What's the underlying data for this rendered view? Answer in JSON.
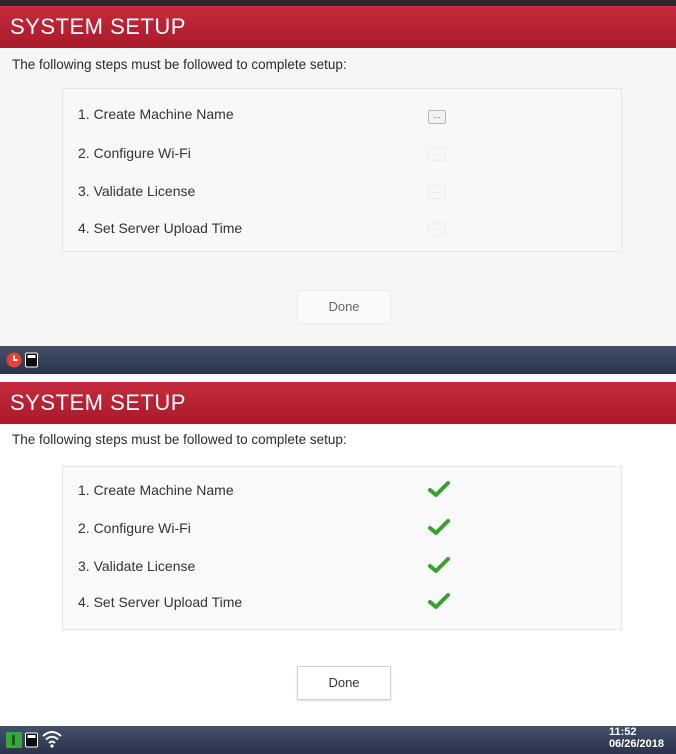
{
  "screens": [
    {
      "title": "SYSTEM SETUP",
      "intro": "The following steps must be followed to complete setup:",
      "steps": [
        {
          "label": "1. Create Machine Name",
          "status_icon": "ellipsis-button",
          "status": "active"
        },
        {
          "label": "2. Configure Wi-Fi",
          "status_icon": "ellipsis-button",
          "status": "disabled"
        },
        {
          "label": "3. Validate License",
          "status_icon": "ellipsis-button",
          "status": "disabled"
        },
        {
          "label": "4. Set Server Upload Time",
          "status_icon": "ellipsis-button",
          "status": "disabled"
        }
      ],
      "ellipsis_text": "...",
      "done_label": "Done",
      "done_enabled": false,
      "taskbar_icons": [
        "clock-alert-icon",
        "card-icon"
      ]
    },
    {
      "title": "SYSTEM SETUP",
      "intro": "The following steps must be followed to complete setup:",
      "steps": [
        {
          "label": "1. Create Machine Name",
          "status_icon": "checkmark-icon",
          "status": "complete"
        },
        {
          "label": "2. Configure Wi-Fi",
          "status_icon": "checkmark-icon",
          "status": "complete"
        },
        {
          "label": "3. Validate License",
          "status_icon": "checkmark-icon",
          "status": "complete"
        },
        {
          "label": "4. Set Server Upload Time",
          "status_icon": "checkmark-icon",
          "status": "complete"
        }
      ],
      "done_label": "Done",
      "done_enabled": true,
      "taskbar_icons": [
        "green-status-icon",
        "card-icon",
        "wifi-icon"
      ],
      "clock": {
        "time": "11:52",
        "date": "06/26/2018"
      }
    }
  ],
  "colors": {
    "title_bar": "#b52132",
    "taskbar": "#34405a",
    "check": "#3aa02e",
    "alert": "#e8412f"
  }
}
